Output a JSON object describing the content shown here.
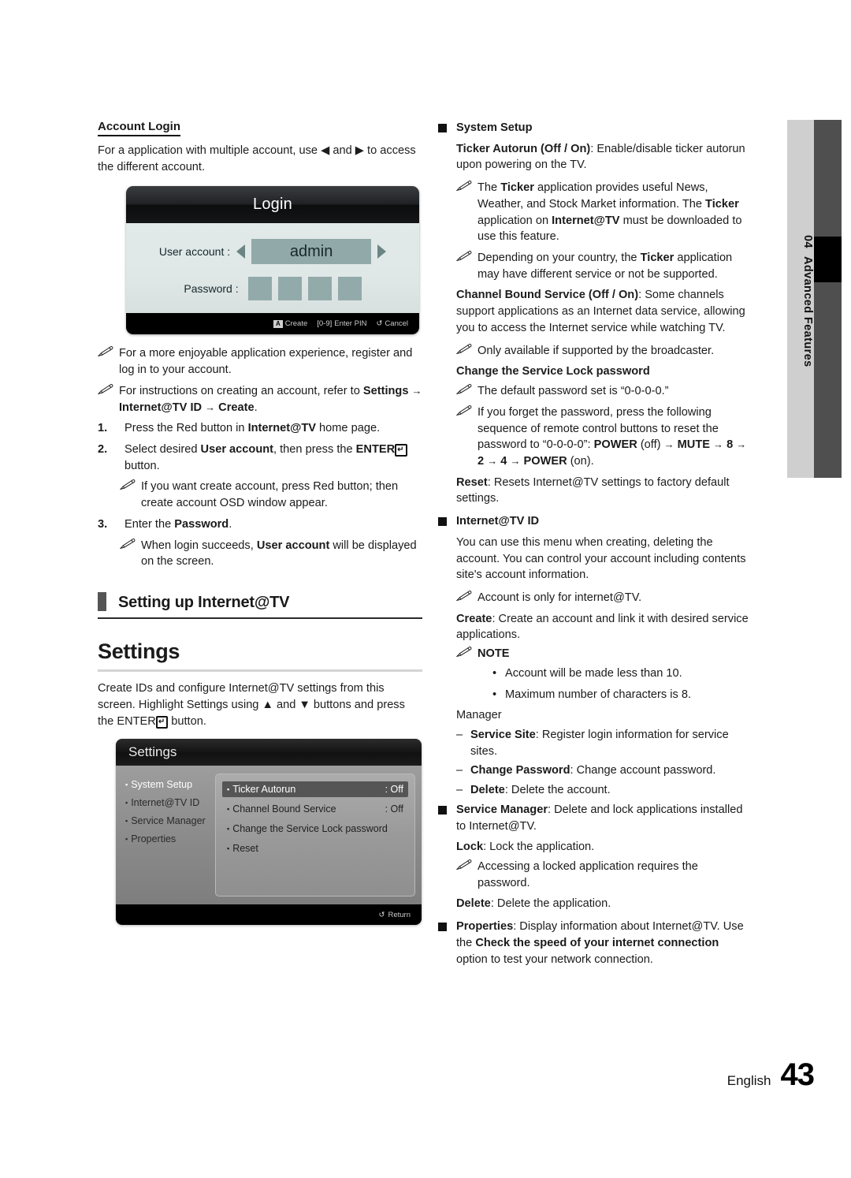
{
  "left": {
    "account_login": {
      "heading": "Account Login",
      "intro": "For a application with multiple account, use ◀ and ▶ to access the different account."
    },
    "login_osd": {
      "title": "Login",
      "user_account_label": "User account :",
      "user_account_value": "admin",
      "password_label": "Password :",
      "password_boxes": 4,
      "hints": [
        {
          "key": "A",
          "label": "Create"
        },
        {
          "key": "[0-9]",
          "label": "Enter PIN"
        },
        {
          "key": "↺",
          "label": "Cancel"
        }
      ]
    },
    "notes": [
      "For a more enjoyable application experience, register and log in to your account.",
      "For instructions on creating an account, refer to Settings → Internet@TV ID → Create."
    ],
    "steps": [
      {
        "n": "1.",
        "text": "Press the Red button in Internet@TV home page."
      },
      {
        "n": "2.",
        "text": "Select desired User account, then press the ENTER button."
      },
      {
        "n": "3.",
        "text": "Enter the Password."
      }
    ],
    "substeps": [
      "If you want create account, press Red button; then create account OSD window appear.",
      "When login succeeds, User account will be displayed on the screen."
    ],
    "section_heading": "Setting up Internet@TV",
    "settings_heading": "Settings",
    "settings_intro": "Create IDs and configure Internet@TV settings from this screen. Highlight Settings using ▲ and ▼ buttons and press the ENTER button.",
    "settings_osd": {
      "title": "Settings",
      "menu": [
        {
          "label": "System Setup",
          "selected": true
        },
        {
          "label": "Internet@TV ID",
          "selected": false
        },
        {
          "label": "Service Manager",
          "selected": false
        },
        {
          "label": "Properties",
          "selected": false
        }
      ],
      "panel": [
        {
          "name": "Ticker Autorun",
          "value": ": Off",
          "highlighted": true
        },
        {
          "name": "Channel Bound Service",
          "value": ": Off",
          "highlighted": false
        },
        {
          "name": "Change the Service Lock password",
          "value": "",
          "highlighted": false
        },
        {
          "name": "Reset",
          "value": "",
          "highlighted": false
        }
      ],
      "return_hint": "Return",
      "return_key": "↺"
    }
  },
  "right": {
    "system_setup": {
      "heading": "System Setup",
      "ticker_bold": "Ticker Autorun (Off / On)",
      "ticker_rest": ": Enable/disable ticker autorun upon powering on the TV.",
      "note1": "The Ticker application provides useful News, Weather, and Stock Market information. The Ticker application on Internet@TV must be downloaded to use this feature.",
      "note2": "Depending on your country, the Ticker application may have different service or not be supported.",
      "channel_bold": "Channel Bound Service (Off / On)",
      "channel_rest": ": Some channels support applications as an Internet data service, allowing you to access the Internet service while watching TV.",
      "note3": "Only available if supported by the broadcaster.",
      "lock_heading": "Change the Service Lock password",
      "note4": "The default password set is “0-0-0-0.”",
      "note5": "If you forget the password, press the following sequence of remote control buttons to reset the password to “0-0-0-0”: POWER (off) → MUTE → 8 → 2 → 4 → POWER (on).",
      "reset_bold": "Reset",
      "reset_rest": ": Resets Internet@TV settings to factory default settings."
    },
    "internet_tv_id": {
      "heading": "Internet@TV ID",
      "body": "You can use this menu when creating, deleting the account. You can control your account including contents site's account information.",
      "note1": "Account is only for internet@TV.",
      "create_bold": "Create",
      "create_rest": ": Create an account and link it with desired service applications.",
      "note_label": "NOTE",
      "note_items": [
        "Account will be made less than 10.",
        "Maximum number of characters is 8."
      ],
      "manager_heading": "Manager",
      "manager_items": [
        {
          "bold": "Service Site",
          "rest": ": Register login information for service sites."
        },
        {
          "bold": "Change Password",
          "rest": ": Change account password."
        },
        {
          "bold": "Delete",
          "rest": ": Delete the account."
        }
      ]
    },
    "service_manager": {
      "heading_bold": "Service Manager",
      "heading_rest": ": Delete and lock applications installed to Internet@TV.",
      "lock_bold": "Lock",
      "lock_rest": ": Lock the application.",
      "note1": "Accessing a locked application requires the password.",
      "delete_bold": "Delete",
      "delete_rest": ": Delete the application."
    },
    "properties": {
      "heading_bold": "Properties",
      "heading_rest1": ": Display information about Internet@TV. Use the ",
      "heading_emph": "Check the speed of your internet connection",
      "heading_rest2": " option to test your network connection."
    }
  },
  "sidetab": {
    "number": "04",
    "label": "Advanced Features"
  },
  "footer": {
    "language": "English",
    "page": "43"
  }
}
